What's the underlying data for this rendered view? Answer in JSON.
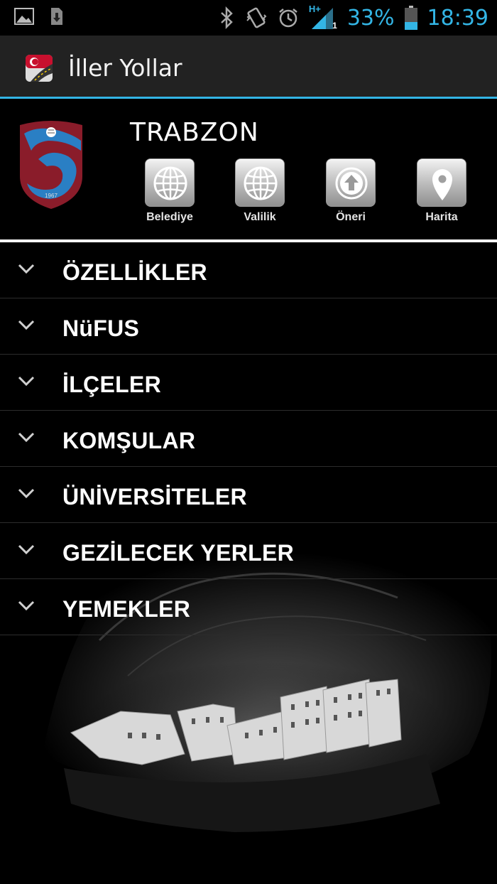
{
  "status_bar": {
    "battery_percent": "33%",
    "time": "18:39",
    "network_label": "H+",
    "sim_slot": "1",
    "icons": [
      "gallery-icon",
      "download-icon",
      "bluetooth-icon",
      "vibrate-icon",
      "alarm-icon",
      "signal-icon",
      "battery-icon"
    ]
  },
  "app_bar": {
    "title": "İller Yollar",
    "icon": "app-logo-icon"
  },
  "city": {
    "name": "TRABZON",
    "crest_year": "1967",
    "actions": [
      {
        "label": "Belediye",
        "icon": "globe-icon"
      },
      {
        "label": "Valilik",
        "icon": "globe-icon"
      },
      {
        "label": "Öneri",
        "icon": "upload-circle-icon"
      },
      {
        "label": "Harita",
        "icon": "map-pin-icon"
      }
    ]
  },
  "menu": {
    "items": [
      {
        "label": "ÖZELLİKLER"
      },
      {
        "label": "NüFUS"
      },
      {
        "label": "İLÇELER"
      },
      {
        "label": "KOMŞULAR"
      },
      {
        "label": "ÜNİVERSİTELER"
      },
      {
        "label": "GEZİLECEK YERLER"
      },
      {
        "label": "YEMEKLER"
      }
    ]
  },
  "colors": {
    "accent": "#33b5e5",
    "crest_blue": "#2a7fc4",
    "crest_maroon": "#8a1c2a"
  }
}
